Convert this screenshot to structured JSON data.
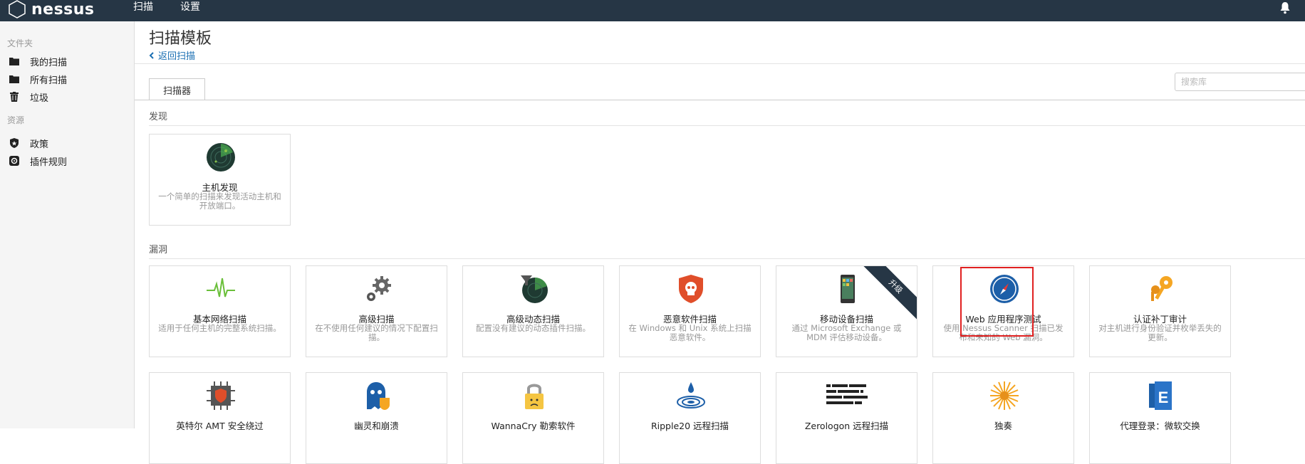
{
  "topbar": {
    "logo": "nessus",
    "nav": [
      "扫描",
      "设置"
    ]
  },
  "sidebar": {
    "folders_header": "文件夹",
    "folders": [
      "我的扫描",
      "所有扫描",
      "垃圾"
    ],
    "resources_header": "资源",
    "resources": [
      "政策",
      "插件规则"
    ]
  },
  "main": {
    "title": "扫描模板",
    "back": "返回扫描",
    "tab": "扫描器",
    "search_placeholder": "搜索库",
    "section_discovery": "发现",
    "section_vuln": "漏洞",
    "discovery_card": {
      "title": "主机发现",
      "desc": "一个简单的扫描来发现活动主机和开放端口。"
    },
    "vuln_cards": [
      {
        "title": "基本网络扫描",
        "desc": "适用于任何主机的完整系统扫描。"
      },
      {
        "title": "高级扫描",
        "desc": "在不使用任何建议的情况下配置扫描。"
      },
      {
        "title": "高级动态扫描",
        "desc": "配置没有建议的动态插件扫描。"
      },
      {
        "title": "恶意软件扫描",
        "desc": "在 Windows 和 Unix 系统上扫描恶意软件。"
      },
      {
        "title": "移动设备扫描",
        "desc": "通过 Microsoft Exchange 或 MDM 评估移动设备。",
        "ribbon": "升级"
      },
      {
        "title": "Web 应用程序测试",
        "desc": "使用 Nessus Scanner 扫描已发布和未知的 Web 漏洞。"
      },
      {
        "title": "认证补丁审计",
        "desc": "对主机进行身份验证并枚举丢失的更新。"
      }
    ],
    "row2_cards": [
      {
        "title": "英特尔 AMT 安全绕过"
      },
      {
        "title": "幽灵和崩溃"
      },
      {
        "title": "WannaCry 勒索软件"
      },
      {
        "title": "Ripple20 远程扫描"
      },
      {
        "title": "Zerologon 远程扫描"
      },
      {
        "title": "独奏"
      },
      {
        "title": "代理登录：微软交换"
      }
    ]
  },
  "colors": {
    "topbar": "#263645",
    "link": "#1a6fb3",
    "highlight": "#e02020"
  }
}
